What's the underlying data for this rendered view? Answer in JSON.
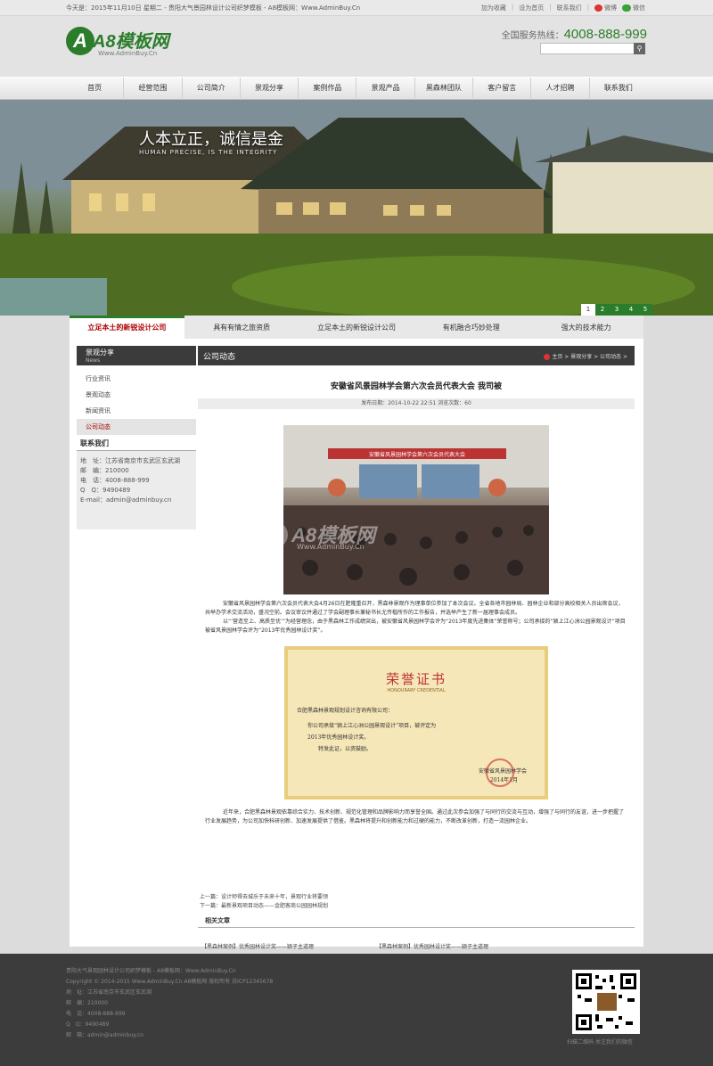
{
  "topbar": {
    "date": "今天是：2015年11月10日 星期二 - 贵阳大气景园林设计公司织梦模板 - A8模板网：Www.AdminBuy.Cn",
    "links": [
      "加为收藏",
      "设为首页",
      "联系我们",
      "微博",
      "微信"
    ]
  },
  "header": {
    "logo_letter": "A",
    "logo_name": "A8模板网",
    "logo_url": "Www.AdminBuy.Cn",
    "hotline_label": "全国服务热线：",
    "hotline_number": "4008-888-999",
    "search_icon": "search-icon"
  },
  "nav": [
    "首页",
    "经营范围",
    "公司简介",
    "景观分享",
    "案例作品",
    "景观产品",
    "黑森林团队",
    "客户留言",
    "人才招聘",
    "联系我们"
  ],
  "banner": {
    "slogan": "人本立正，诚信是金",
    "slogan_en": "HUMAN PRECISE, IS THE INTEGRITY",
    "pages": [
      "1",
      "2",
      "3",
      "4",
      "5"
    ],
    "active_page": "1"
  },
  "features": [
    "立足本土的新锐设计公司",
    "具有有情之旅资质",
    "立足本土的新锐设计公司",
    "有机融合巧妙处理",
    "强大的技术能力"
  ],
  "sidebar": {
    "title_cn": "景观分享",
    "title_en": "News",
    "items": [
      "行业资讯",
      "景观动态",
      "新闻资讯",
      "公司动态"
    ],
    "active_item": "公司动态",
    "contact_title": "联系我们",
    "contact": [
      "地　址：江苏省南京市玄武区玄武湖",
      "邮　编：210000",
      "电　话：4008-888-999",
      "Q　Q：9490489",
      "E-mail：admin@adminbuy.cn"
    ]
  },
  "content": {
    "section_title": "公司动态",
    "breadcrumb": "主页 > 景观分享 > 公司动态 >",
    "article_title": "安徽省风景园林学会第六次会员代表大会 我司被",
    "meta": "发布日期：2014-10-22 22:51  浏览次数：60",
    "photo_banner": "安徽省风景园林学会第六次会员代表大会",
    "watermark": "A8模板网",
    "watermark_url": "Www.AdminBuy.Cn",
    "para1": "安徽省风景园林学会第六次会员代表大会4月26日在肥隆重召开，黑森林景观作为理事单位参加了本次会议。全省各地市园林局、园林企业和部分高校相关人员出席会议，共举办学术交流活动，盛况空前。会议审议并通过了学会副理事长兼秘书长尤传楷所作的工作报告，并选举产生了新一届理事会成员。",
    "para2": "以“‘营造至上、高质至优’”为经营理念，由于黑森林工作成绩突出，被安徽省风景园林学会评为“2013年度先进集体”荣誉称号；公司承接的“颍上江心洲公园景观设计”项目被省风景园林学会评为“2013年优秀园林设计奖”。",
    "cert_title": "荣誉证书",
    "cert_sub": "HONOURARY CREDENTIAL",
    "cert_company": "合肥黑森林景观规划设计咨询有限公司：",
    "cert_body1": "你公司承接“颍上江心洲公园景观设计”项目，被评定为",
    "cert_body2": "2013年优秀园林设计奖。",
    "cert_body3": "特发此证，以资鼓励。",
    "cert_issuer": "安徽省风景园林学会",
    "cert_date": "2014年1月",
    "para3": "近年来，合肥黑森林景观依靠综合实力、技术创新、规范化管理和品牌影响力而享誉全国。通过此次参会加强了与同行的交流与互动，增强了与同行的友谊，进一步把握了行业发展趋势，为公司加快科研创新、加速发展提供了借鉴。黑森林将提升和创新能力和过硬的能力，不断改革创新，打造一流园林企业。",
    "prev": "上一篇：设计师得去城乐于未来十年，景观行业将要领",
    "next": "下一篇：最新景观项目动态——金肥客商公园园林规划",
    "related_title": "相关文章",
    "related": [
      "【黑森林案例】优秀园林设计奖——颍子主道理",
      "【黑森林案例】优秀园林设计奖——颍子主道理"
    ]
  },
  "footer": {
    "lines": [
      "贵阳大气景观园林设计公司织梦模板 - A8模板网：Www.AdminBuy.Cn",
      "Copyright © 2014-2015 Www.AdminBuy.Cn A8模板网 版权所有  苏ICP12345678",
      "地　址：江苏省南京市玄武区玄武湖",
      "邮　编：210000",
      "电　话：4008-888-999",
      "Q　Q：9490489",
      "邮　箱：admin@adminbuy.cn"
    ],
    "qr_caption": "扫描二维码 关注我们的微信"
  },
  "colors": {
    "brand_green": "#2b7d2b",
    "accent_red": "#aa0000",
    "dark_header": "#3b3b3b"
  }
}
